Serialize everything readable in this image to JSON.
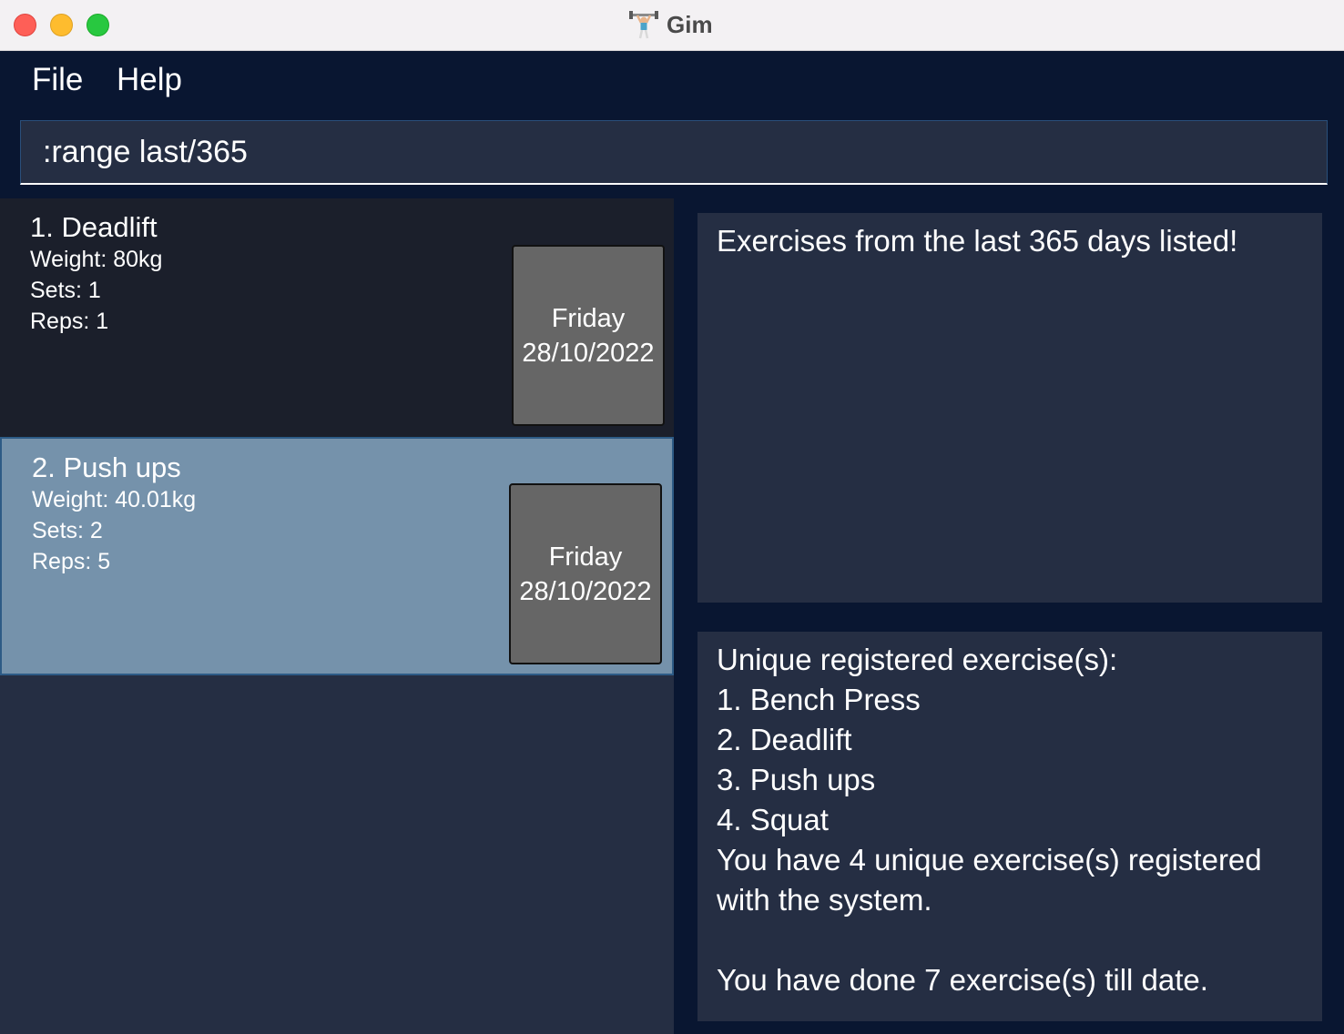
{
  "window": {
    "title": "Gim",
    "app_icon": "weightlifter-icon"
  },
  "menu": {
    "file": "File",
    "help": "Help"
  },
  "command": {
    "value": ":range last/365"
  },
  "exercises": [
    {
      "title": "1.  Deadlift",
      "weight": "Weight: 80kg",
      "sets": "Sets: 1",
      "reps": "Reps: 1",
      "day": "Friday",
      "date": "28/10/2022",
      "selected": false
    },
    {
      "title": "2.  Push ups",
      "weight": "Weight: 40.01kg",
      "sets": "Sets: 2",
      "reps": "Reps: 5",
      "day": "Friday",
      "date": "28/10/2022",
      "selected": true
    }
  ],
  "result": {
    "message": "Exercises from the last 365 days listed!"
  },
  "stats": {
    "heading": "Unique registered exercise(s):",
    "items": [
      "1. Bench Press",
      "2. Deadlift",
      "3. Push ups",
      "4. Squat"
    ],
    "summary_line1": "You have 4 unique exercise(s) registered",
    "summary_line2": "with the system.",
    "total": "You have done 7 exercise(s) till date."
  },
  "colors": {
    "background": "#091631",
    "panel": "#252e43",
    "card_default": "#1b1f2b",
    "card_selected": "#7592ab",
    "date_box": "#666666"
  }
}
